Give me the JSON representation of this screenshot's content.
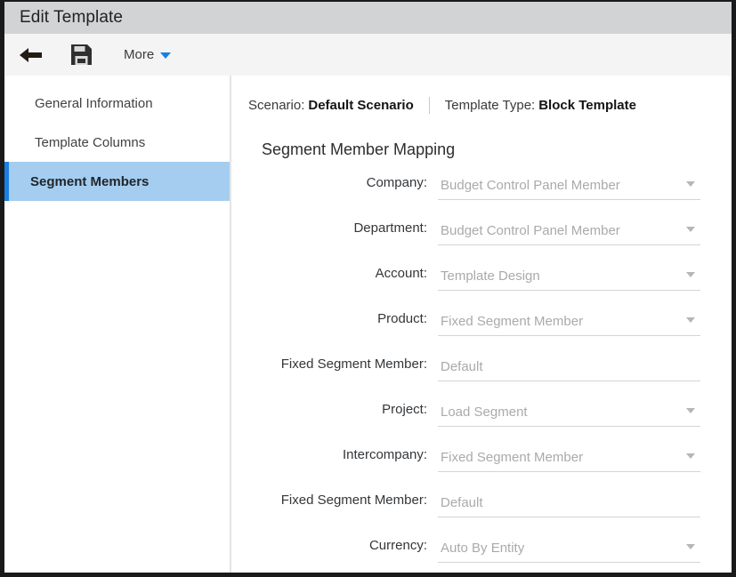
{
  "window": {
    "title": "Edit Template"
  },
  "toolbar": {
    "back_icon": "back-arrow-icon",
    "save_icon": "floppy-disk-save-icon",
    "more_label": "More",
    "more_caret_icon": "chevron-down-icon",
    "accent_color": "#1a7fe0"
  },
  "sidebar": {
    "items": [
      {
        "label": "General Information",
        "active": false
      },
      {
        "label": "Template Columns",
        "active": false
      },
      {
        "label": "Segment Members",
        "active": true
      }
    ],
    "active_bg": "#a5cdef",
    "active_accent": "#1a7fe0"
  },
  "content": {
    "scenario_label": "Scenario:",
    "scenario_value": "Default Scenario",
    "template_type_label": "Template Type:",
    "template_type_value": "Block Template",
    "section_title": "Segment Member Mapping",
    "fields": [
      {
        "label": "Company:",
        "value": "Budget Control Panel Member",
        "has_dropdown": true
      },
      {
        "label": "Department:",
        "value": "Budget Control Panel Member",
        "has_dropdown": true
      },
      {
        "label": "Account:",
        "value": "Template Design",
        "has_dropdown": true
      },
      {
        "label": "Product:",
        "value": "Fixed Segment Member",
        "has_dropdown": true
      },
      {
        "label": "Fixed Segment Member:",
        "value": "Default",
        "has_dropdown": false
      },
      {
        "label": "Project:",
        "value": "Load Segment",
        "has_dropdown": true
      },
      {
        "label": "Intercompany:",
        "value": "Fixed Segment Member",
        "has_dropdown": true
      },
      {
        "label": "Fixed Segment Member:",
        "value": "Default",
        "has_dropdown": false
      },
      {
        "label": "Currency:",
        "value": "Auto By Entity",
        "has_dropdown": true
      }
    ]
  }
}
